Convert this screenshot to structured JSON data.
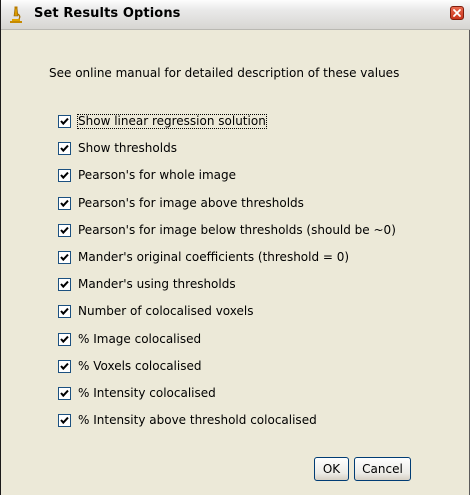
{
  "window": {
    "title": "Set Results Options"
  },
  "description": "See online manual for detailed description of these values",
  "options": [
    {
      "label": "Show linear regression solution",
      "checked": true
    },
    {
      "label": "Show thresholds",
      "checked": true
    },
    {
      "label": "Pearson's for whole image",
      "checked": true
    },
    {
      "label": "Pearson's for image above thresholds",
      "checked": true
    },
    {
      "label": "Pearson's for image below thresholds (should be ~0)",
      "checked": true
    },
    {
      "label": "Mander's original coefficients (threshold = 0)",
      "checked": true
    },
    {
      "label": "Mander's using thresholds",
      "checked": true
    },
    {
      "label": "Number of colocalised voxels",
      "checked": true
    },
    {
      "label": "% Image colocalised",
      "checked": true
    },
    {
      "label": "% Voxels colocalised",
      "checked": true
    },
    {
      "label": "% Intensity colocalised",
      "checked": true
    },
    {
      "label": "% Intensity above threshold colocalised",
      "checked": true
    }
  ],
  "buttons": {
    "ok_label": "OK",
    "cancel_label": "Cancel"
  },
  "icons": {
    "title": "microscope-icon",
    "close": "close-icon",
    "check": "checkmark-icon"
  },
  "colors": {
    "dialog_background": "#ece9d8",
    "checkbox_border": "#1c5180",
    "close_button": "#c9331b"
  }
}
